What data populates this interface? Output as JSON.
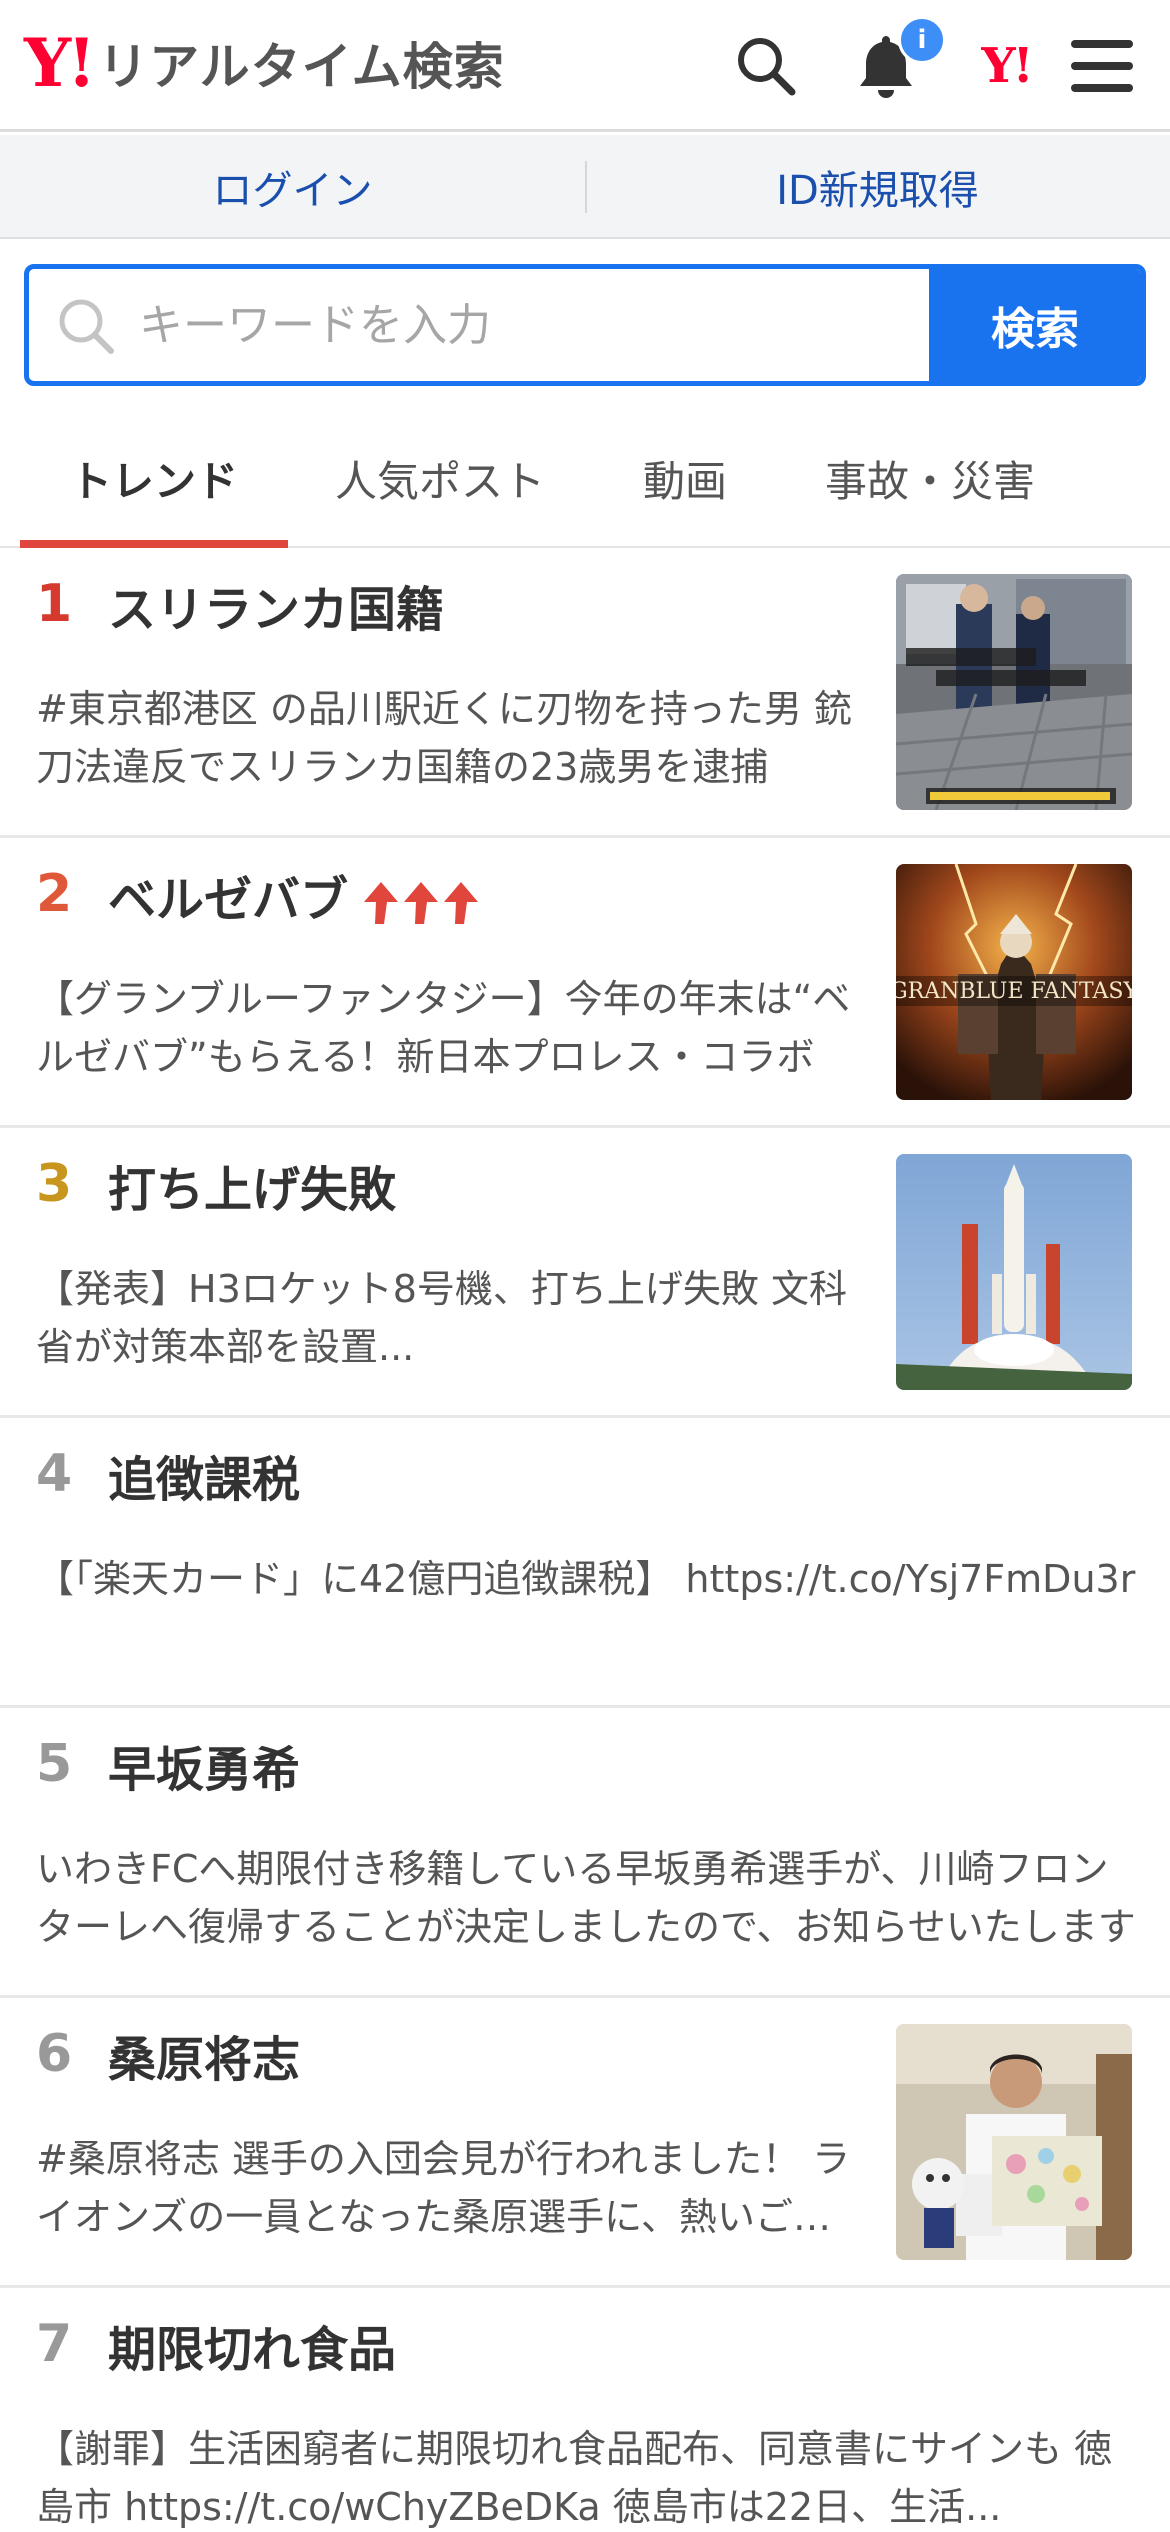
{
  "header": {
    "logo_mark": "Y!",
    "logo_text": "リアルタイム検索",
    "notification_badge": "i",
    "yahoo_mark": "Y!",
    "icons": [
      "search-icon",
      "bell-icon",
      "yahoo-logo-icon",
      "menu-icon"
    ]
  },
  "auth": {
    "login": "ログイン",
    "signup": "ID新規取得"
  },
  "search": {
    "placeholder": "キーワードを入力",
    "value": "",
    "button": "検索"
  },
  "tabs": [
    {
      "label": "トレンド",
      "active": true
    },
    {
      "label": "人気ポスト",
      "active": false
    },
    {
      "label": "動画",
      "active": false
    },
    {
      "label": "事故・災害",
      "active": false
    }
  ],
  "trends": [
    {
      "rank": "1",
      "title": "スリランカ国籍",
      "desc": "#東京都港区 の品川駅近くに刃物を持った男 銃刀法違反でスリランカ国籍の23歳男を逮捕",
      "rank_color": "#d63a2f",
      "has_thumb": true,
      "thumb": "news-photo-police"
    },
    {
      "rank": "2",
      "title": "ベルゼバブ",
      "desc": "【グランブルーファンタジー】今年の年末は“ベルゼバブ”もらえる！新日本プロレス・コラボ",
      "rank_color": "#e0583a",
      "has_thumb": true,
      "thumb": "game-art-granblue",
      "rising_arrows": 3
    },
    {
      "rank": "3",
      "title": "打ち上げ失敗",
      "desc": "【発表】H3ロケット8号機、打ち上げ失敗 文科省が対策本部を設置...",
      "rank_color": "#c8961e",
      "has_thumb": true,
      "thumb": "rocket-launch-photo"
    },
    {
      "rank": "4",
      "title": "追徴課税",
      "desc": "【「楽天カード」に42億円追徴課税】 https://t.co/Ysj7FmDu3r",
      "rank_color": "#999999",
      "has_thumb": false
    },
    {
      "rank": "5",
      "title": "早坂勇希",
      "desc": "いわきFCへ期限付き移籍している早坂勇希選手が、川崎フロンターレへ復帰することが決定しましたので、お知らせいたします",
      "rank_color": "#999999",
      "has_thumb": false
    },
    {
      "rank": "6",
      "title": "桑原将志",
      "desc": "#桑原将志 選手の入団会見が行われました！ ライオンズの一員となった桑原選手に、熱いご声援を",
      "rank_color": "#999999",
      "has_thumb": true,
      "thumb": "press-conference-photo"
    },
    {
      "rank": "7",
      "title": "期限切れ食品",
      "desc": "【謝罪】生活困窮者に期限切れ食品配布、同意書にサインも 徳島市 https://t.co/wChyZBeDKa 徳島市は22日、生活...",
      "rank_color": "#999999",
      "has_thumb": false
    }
  ]
}
